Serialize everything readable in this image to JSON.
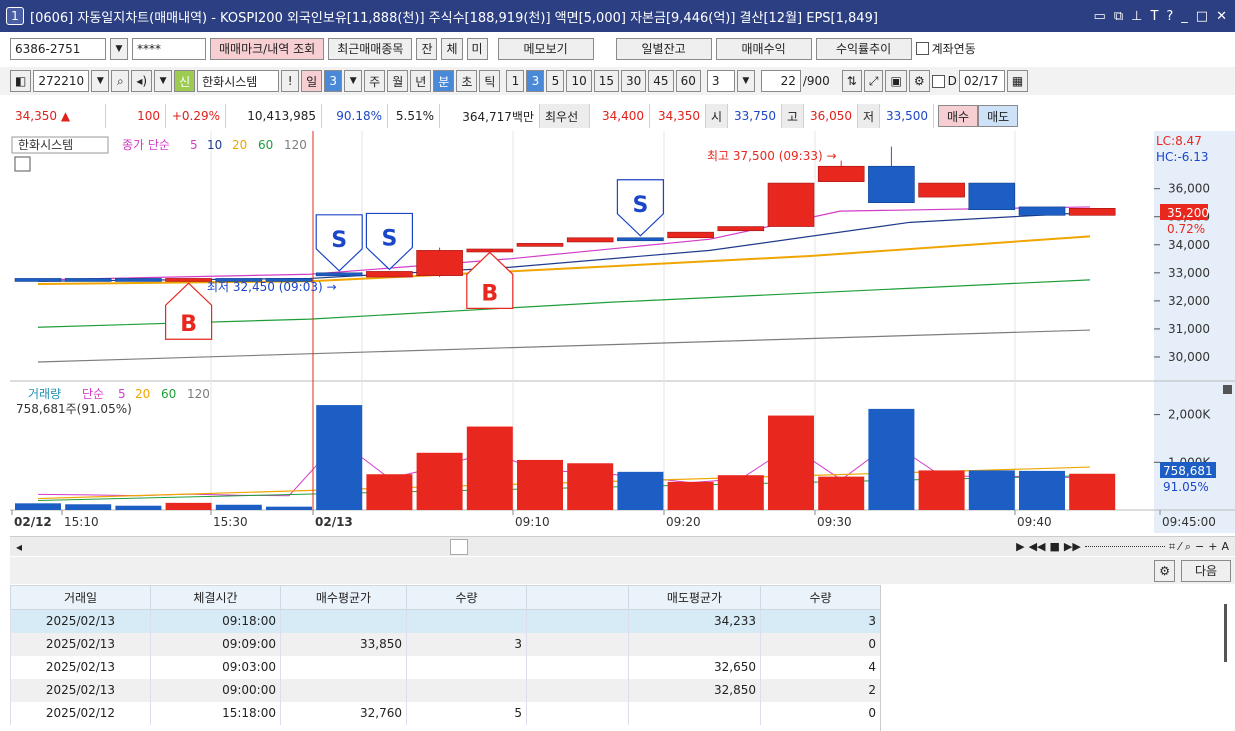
{
  "title": {
    "num": "1",
    "text": "[0606] 자동일지차트(매매내역) - KOSPI200 외국인보유[11,888(천)] 주식수[188,919(천)] 액면[5,000] 자본금[9,446(억)] 결산[12월] EPS[1,849]",
    "icons": [
      "window-icon",
      "copy-icon",
      "pin-icon",
      "font-icon",
      "help-icon",
      "minimize-icon",
      "maximize-icon",
      "close-icon"
    ]
  },
  "toolbar1": {
    "account": "6386-2751",
    "password": "****",
    "btn_mark": "매매마크/내역 조회",
    "btn_recent": "최근매매종목",
    "btn_jan": "잔",
    "btn_che": "체",
    "btn_mi": "미",
    "btn_memo": "메모보기",
    "btn_daily": "일별잔고",
    "btn_profit": "매매수익",
    "btn_rate": "수익률추이",
    "link_label": "계좌연동"
  },
  "toolbar2": {
    "code": "272210",
    "sin": "신",
    "name": "한화시스템",
    "excl": "!",
    "il": "일",
    "il_num": "3",
    "periods": [
      "주",
      "월",
      "년"
    ],
    "bun": "분",
    "cho": "초",
    "tick": "틱",
    "intervals": [
      "1",
      "3",
      "5",
      "10",
      "15",
      "30",
      "45",
      "60"
    ],
    "sel_interval": "3",
    "count_sel": "3",
    "count": "22",
    "count_total": "/900",
    "d_label": "D",
    "date": "02/17"
  },
  "quote": {
    "price": "34,350",
    "change": "100",
    "rate": "+0.29%",
    "volume": "10,413,985",
    "vol_ratio": "90.18%",
    "turnover": "5.51%",
    "amount": "364,717백만",
    "best_label": "최우선",
    "best_ask": "34,400",
    "best_bid": "34,350",
    "open_label": "시",
    "open": "33,750",
    "high_label": "고",
    "high": "36,050",
    "low_label": "저",
    "low": "33,500",
    "buy": "매수",
    "sell": "매도"
  },
  "chart": {
    "legend_stock": "한화시스템",
    "legend_close": "종가 단순",
    "ma_periods": [
      "5",
      "10",
      "20",
      "60",
      "120"
    ],
    "vol_legend": "거래량",
    "vol_simple": "단순",
    "vol_periods": [
      "5",
      "20",
      "60",
      "120"
    ],
    "vol_current": "758,681주(91.05%)",
    "lc": "LC:8.47",
    "hc": "HC:-6.13",
    "price_tag": "35,200",
    "price_tag_rate": "0.72%",
    "vol_tag": "758,681",
    "vol_tag_rate": "91.05%",
    "high_annot": "최고 37,500 (09:33) →",
    "low_annot": "최저 32,450 (09:03) →",
    "y_ticks": [
      "31,000",
      "36,000",
      "35,000",
      "34,000",
      "33,000",
      "32,000",
      "31,000",
      "30,000"
    ],
    "vol_ticks": [
      "2,000K",
      "1,000K"
    ],
    "x_labels": [
      "02/12",
      "15:10",
      "15:30",
      "02/13",
      "09:10",
      "09:20",
      "09:30",
      "09:40",
      "09:45:00"
    ],
    "colors": {
      "up": "#e8281e",
      "down": "#1c5ec4",
      "ma5": "#d23dc8",
      "ma10": "#1f3a8c",
      "ma20": "#f0a500",
      "ma60": "#1e9e3a",
      "ma120": "#7d7d7d"
    }
  },
  "chart_data": {
    "type": "candlestick",
    "candles": [
      {
        "o": 32800,
        "c": 32700
      },
      {
        "o": 32800,
        "c": 32700
      },
      {
        "o": 32800,
        "c": 32700
      },
      {
        "o": 32700,
        "c": 32800
      },
      {
        "o": 32800,
        "c": 32700
      },
      {
        "o": 32800,
        "c": 32700
      },
      {
        "o": 33000,
        "c": 32900
      },
      {
        "o": 32850,
        "c": 33050
      },
      {
        "o": 32900,
        "c": 33800,
        "h": 33900,
        "l": 32850
      },
      {
        "o": 33800,
        "c": 33850
      },
      {
        "o": 33950,
        "c": 34050
      },
      {
        "o": 34100,
        "c": 34250
      },
      {
        "o": 34250,
        "c": 34200
      },
      {
        "o": 34250,
        "c": 34450
      },
      {
        "o": 34500,
        "c": 34650
      },
      {
        "o": 34650,
        "c": 36200
      },
      {
        "o": 36250,
        "c": 36800,
        "h": 37000
      },
      {
        "o": 36800,
        "c": 35500,
        "h": 37500
      },
      {
        "o": 35700,
        "c": 36200
      },
      {
        "o": 36200,
        "c": 35250
      },
      {
        "o": 35350,
        "c": 35050
      },
      {
        "o": 35050,
        "c": 35300
      }
    ],
    "volume": [
      140,
      120,
      90,
      150,
      110,
      70,
      2200,
      750,
      1200,
      1750,
      1050,
      980,
      800,
      590,
      730,
      1980,
      700,
      2120,
      830,
      830,
      820,
      760
    ],
    "markers": [
      {
        "index": 3,
        "type": "B"
      },
      {
        "index": 6,
        "type": "S"
      },
      {
        "index": 7,
        "type": "S"
      },
      {
        "index": 9,
        "type": "B"
      },
      {
        "index": 12,
        "type": "S"
      }
    ]
  },
  "toolstrip": {
    "next": "다음"
  },
  "trades": {
    "headers": [
      "거래일",
      "체결시간",
      "매수평균가",
      "수량",
      "",
      "매도평균가",
      "수량"
    ],
    "rows": [
      [
        "2025/02/13",
        "09:18:00",
        "",
        "",
        "",
        "34,233",
        "3"
      ],
      [
        "2025/02/13",
        "09:09:00",
        "33,850",
        "3",
        "",
        "",
        "0"
      ],
      [
        "2025/02/13",
        "09:03:00",
        "",
        "",
        "",
        "32,650",
        "4"
      ],
      [
        "2025/02/13",
        "09:00:00",
        "",
        "",
        "",
        "32,850",
        "2"
      ],
      [
        "2025/02/12",
        "15:18:00",
        "32,760",
        "5",
        "",
        "",
        "0"
      ]
    ]
  }
}
